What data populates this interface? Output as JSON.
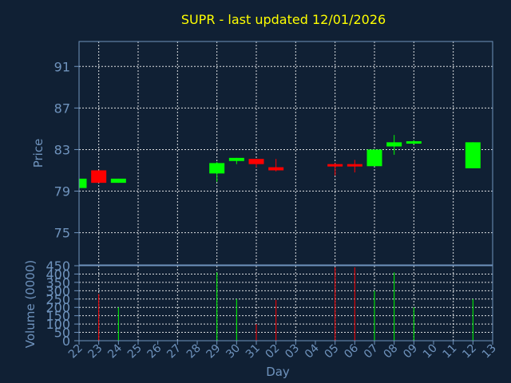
{
  "chart_data": {
    "type": "candlestick",
    "title": "SUPR - last updated 12/01/2026",
    "xlabel": "Day",
    "price_panel": {
      "ylabel": "Price",
      "yticks": [
        75,
        79,
        83,
        87,
        91
      ],
      "ylim": [
        71.9,
        93.4
      ],
      "grid": true
    },
    "volume_panel": {
      "ylabel": "Volume (0000)",
      "yticks": [
        0,
        50,
        100,
        150,
        200,
        250,
        300,
        350,
        400,
        450
      ],
      "ylim": [
        0,
        450
      ],
      "grid": true
    },
    "categories": [
      "22",
      "23",
      "24",
      "25",
      "26",
      "27",
      "28",
      "29",
      "30",
      "31",
      "02",
      "03",
      "04",
      "05",
      "06",
      "07",
      "08",
      "09",
      "10",
      "11",
      "12",
      "13"
    ],
    "candles": [
      {
        "day": "22",
        "open": 79.3,
        "high": 80.2,
        "low": 79.2,
        "close": 80.2,
        "direction": "up"
      },
      {
        "day": "23",
        "open": 81.0,
        "high": 81.0,
        "low": 79.8,
        "close": 79.8,
        "direction": "down"
      },
      {
        "day": "24",
        "open": 79.8,
        "high": 80.2,
        "low": 79.8,
        "close": 80.2,
        "direction": "up"
      },
      {
        "day": "29",
        "open": 80.7,
        "high": 81.8,
        "low": 79.9,
        "close": 81.7,
        "direction": "up"
      },
      {
        "day": "30",
        "open": 81.9,
        "high": 82.2,
        "low": 81.6,
        "close": 82.2,
        "direction": "up"
      },
      {
        "day": "31",
        "open": 82.1,
        "high": 82.1,
        "low": 81.3,
        "close": 81.6,
        "direction": "down"
      },
      {
        "day": "02",
        "open": 81.3,
        "high": 82.1,
        "low": 80.9,
        "close": 81.0,
        "direction": "down"
      },
      {
        "day": "05",
        "open": 81.6,
        "high": 81.7,
        "low": 80.5,
        "close": 81.4,
        "direction": "down"
      },
      {
        "day": "06",
        "open": 81.6,
        "high": 82.0,
        "low": 80.8,
        "close": 81.4,
        "direction": "down"
      },
      {
        "day": "07",
        "open": 81.4,
        "high": 83.0,
        "low": 81.4,
        "close": 83.0,
        "direction": "up"
      },
      {
        "day": "08",
        "open": 83.3,
        "high": 84.4,
        "low": 82.5,
        "close": 83.7,
        "direction": "up"
      },
      {
        "day": "09",
        "open": 83.7,
        "high": 83.9,
        "low": 83.5,
        "close": 83.8,
        "direction": "up"
      },
      {
        "day": "12",
        "open": 81.2,
        "high": 83.7,
        "low": 81.2,
        "close": 83.7,
        "direction": "up"
      }
    ],
    "volume": [
      {
        "day": "23",
        "value": 280,
        "direction": "down"
      },
      {
        "day": "24",
        "value": 200,
        "direction": "up"
      },
      {
        "day": "29",
        "value": 410,
        "direction": "up"
      },
      {
        "day": "30",
        "value": 250,
        "direction": "up"
      },
      {
        "day": "31",
        "value": 100,
        "direction": "down"
      },
      {
        "day": "02",
        "value": 245,
        "direction": "down"
      },
      {
        "day": "05",
        "value": 440,
        "direction": "down"
      },
      {
        "day": "06",
        "value": 440,
        "direction": "down"
      },
      {
        "day": "07",
        "value": 300,
        "direction": "up"
      },
      {
        "day": "08",
        "value": 410,
        "direction": "up"
      },
      {
        "day": "09",
        "value": 200,
        "direction": "up"
      },
      {
        "day": "12",
        "value": 250,
        "direction": "up"
      }
    ],
    "colors": {
      "background": "#102034",
      "title": "#ffff00",
      "axis_text": "#6f93bd",
      "frame": "#6f93bd",
      "grid": "#ffffff",
      "up": "#00ff00",
      "down": "#ff0000"
    }
  }
}
